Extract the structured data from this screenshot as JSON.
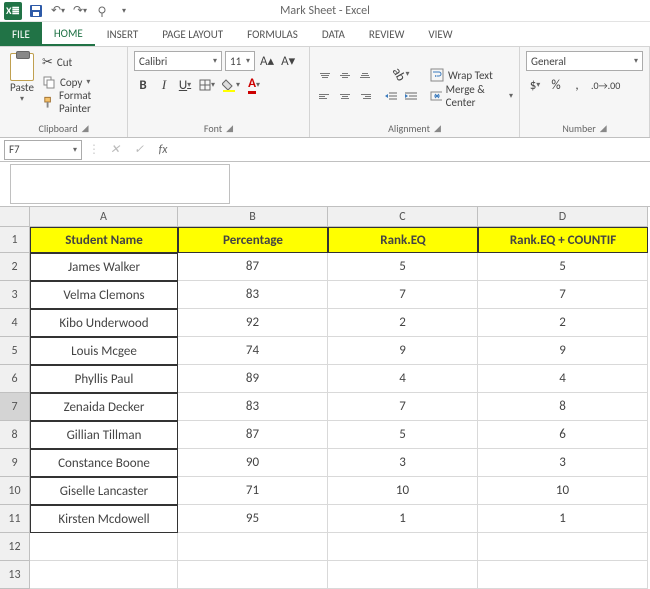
{
  "titlebar": {
    "title": "Mark Sheet - Excel",
    "app_abbrev": "X≣"
  },
  "tabs": [
    "FILE",
    "HOME",
    "INSERT",
    "PAGE LAYOUT",
    "FORMULAS",
    "DATA",
    "REVIEW",
    "VIEW"
  ],
  "active_tab": "HOME",
  "ribbon": {
    "clipboard": {
      "paste": "Paste",
      "cut": "Cut",
      "copy": "Copy",
      "format_painter": "Format Painter",
      "label": "Clipboard"
    },
    "font": {
      "name": "Calibri",
      "size": "11",
      "label": "Font"
    },
    "alignment": {
      "wrap": "Wrap Text",
      "merge": "Merge & Center",
      "label": "Alignment"
    },
    "number": {
      "format": "General",
      "label": "Number"
    }
  },
  "namebox": "F7",
  "columns": [
    "A",
    "B",
    "C",
    "D"
  ],
  "headers": [
    "Student Name",
    "Percentage",
    "Rank.EQ",
    "Rank.EQ + COUNTIF"
  ],
  "rows": [
    {
      "n": 2,
      "name": "James Walker",
      "pct": 87,
      "rank": 5,
      "rankc": 5
    },
    {
      "n": 3,
      "name": "Velma Clemons",
      "pct": 83,
      "rank": 7,
      "rankc": 7
    },
    {
      "n": 4,
      "name": "Kibo Underwood",
      "pct": 92,
      "rank": 2,
      "rankc": 2
    },
    {
      "n": 5,
      "name": "Louis Mcgee",
      "pct": 74,
      "rank": 9,
      "rankc": 9
    },
    {
      "n": 6,
      "name": "Phyllis Paul",
      "pct": 89,
      "rank": 4,
      "rankc": 4
    },
    {
      "n": 7,
      "name": "Zenaida Decker",
      "pct": 83,
      "rank": 7,
      "rankc": 8
    },
    {
      "n": 8,
      "name": "Gillian Tillman",
      "pct": 87,
      "rank": 5,
      "rankc": 6
    },
    {
      "n": 9,
      "name": "Constance Boone",
      "pct": 90,
      "rank": 3,
      "rankc": 3
    },
    {
      "n": 10,
      "name": "Giselle Lancaster",
      "pct": 71,
      "rank": 10,
      "rankc": 10
    },
    {
      "n": 11,
      "name": "Kirsten Mcdowell",
      "pct": 95,
      "rank": 1,
      "rankc": 1
    }
  ],
  "empty_rows": [
    12,
    13
  ],
  "selected_row": 7
}
